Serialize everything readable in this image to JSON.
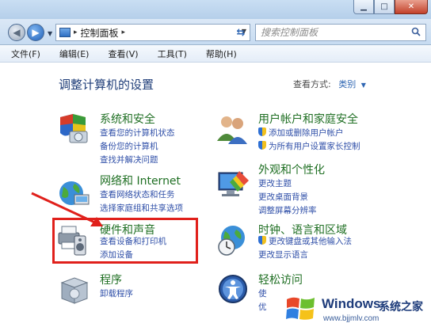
{
  "window": {
    "controls": {
      "minimize": "▁",
      "maximize": "□",
      "close": "✕"
    }
  },
  "address_bar": {
    "path_chevron": "▸",
    "path": "控制面板",
    "path_after": "▸",
    "search_placeholder": "搜索控制面板",
    "refresh_glyph": "⇆"
  },
  "menu": [
    "文件(F)",
    "编辑(E)",
    "查看(V)",
    "工具(T)",
    "帮助(H)"
  ],
  "main": {
    "title": "调整计算机的设置",
    "view_by_label": "查看方式:",
    "view_by_value": "类别"
  },
  "categories": [
    {
      "title": "系统和安全",
      "links": [
        "查看您的计算机状态",
        "备份您的计算机",
        "查找并解决问题"
      ],
      "icon": "shield-flag-icon"
    },
    {
      "title": "用户帐户和家庭安全",
      "links": [
        "添加或删除用户帐户",
        "为所有用户设置家长控制"
      ],
      "icon": "users-icon"
    },
    {
      "title": "网络和 Internet",
      "links": [
        "查看网络状态和任务",
        "选择家庭组和共享选项"
      ],
      "icon": "network-globe-icon"
    },
    {
      "title": "外观和个性化",
      "links": [
        "更改主题",
        "更改桌面背景",
        "调整屏幕分辨率"
      ],
      "icon": "monitor-paint-icon"
    },
    {
      "title": "硬件和声音",
      "links": [
        "查看设备和打印机",
        "添加设备"
      ],
      "icon": "printer-speaker-icon"
    },
    {
      "title": "时钟、语言和区域",
      "links": [
        "更改键盘或其他输入法",
        "更改显示语言"
      ],
      "icon": "clock-globe-icon"
    },
    {
      "title": "程序",
      "links": [
        "卸载程序"
      ],
      "icon": "programs-box-icon"
    },
    {
      "title": "轻松访问",
      "links": [
        "使",
        "优"
      ],
      "icon": "ease-of-access-icon"
    }
  ],
  "watermark": {
    "title": "Windows",
    "subtitle": "系统之家",
    "url": "www.bjjmlv.com"
  },
  "colors": {
    "title_blue": "#1e3d78",
    "category_green": "#1f6f23",
    "link_blue": "#2f4fa8",
    "highlight_red": "#e0201b"
  }
}
